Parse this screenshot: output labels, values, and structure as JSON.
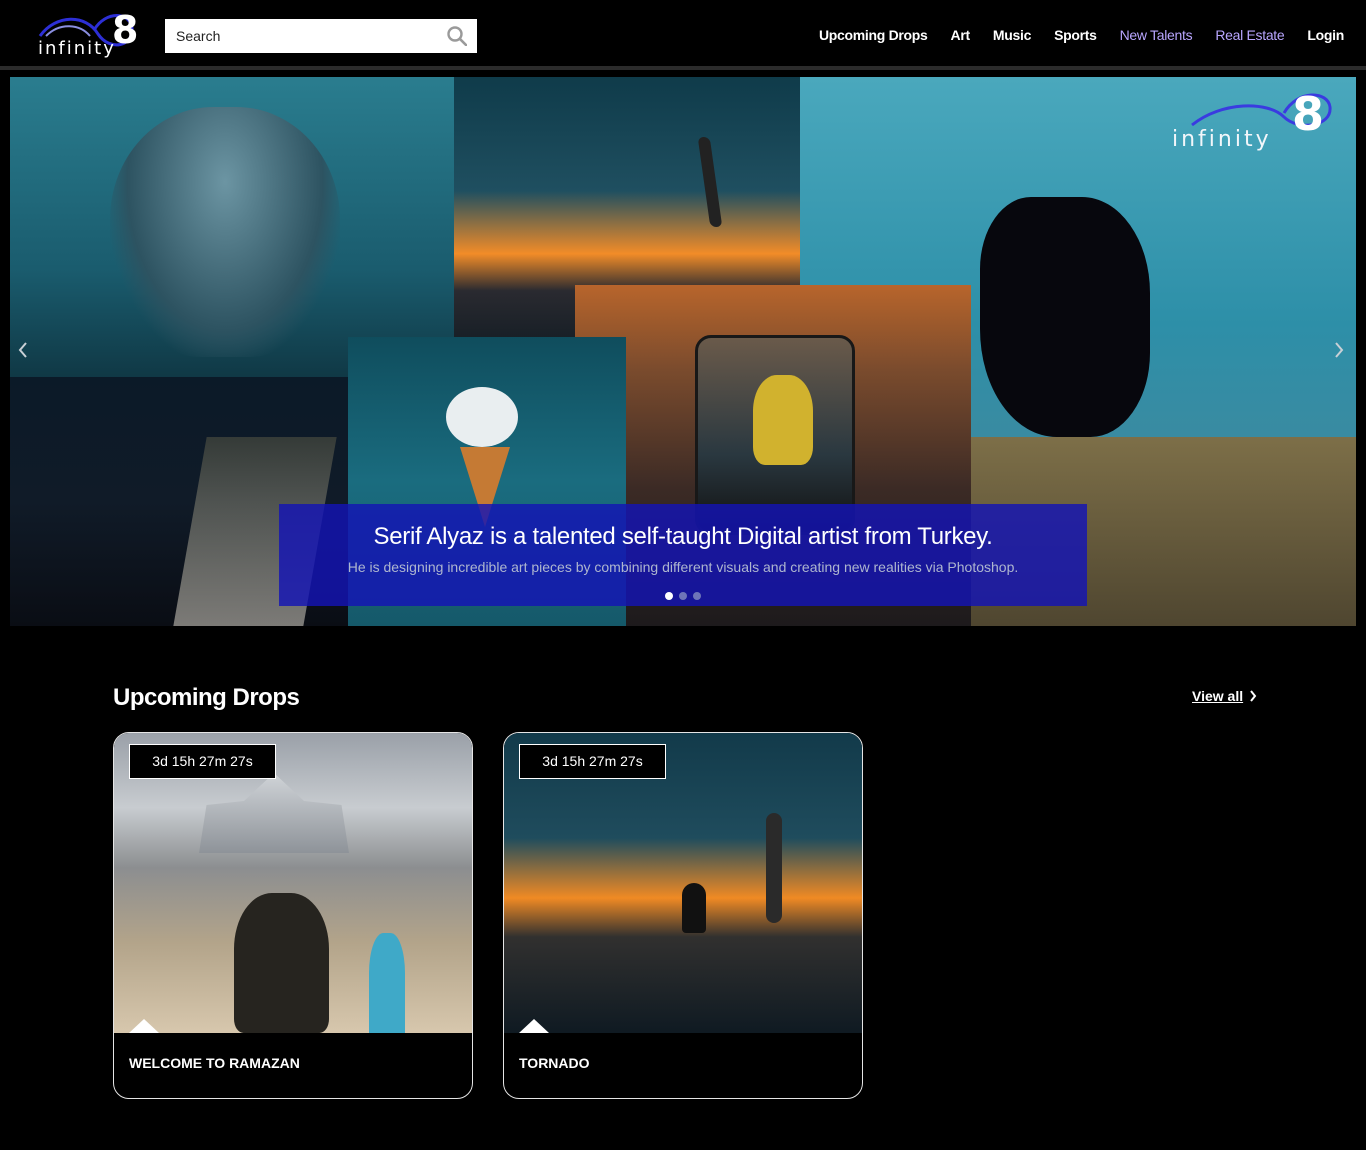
{
  "header": {
    "logo_word": "infinity",
    "logo_mark": "8",
    "search_placeholder": "Search",
    "nav": [
      {
        "label": "Upcoming Drops"
      },
      {
        "label": "Art"
      },
      {
        "label": "Music"
      },
      {
        "label": "Sports"
      },
      {
        "label": "New Talents",
        "color": "#b9a6ff"
      },
      {
        "label": "Real Estate",
        "color": "#b9a6ff"
      },
      {
        "label": "Login"
      }
    ]
  },
  "hero": {
    "watermark_word": "infinity",
    "watermark_mark": "8",
    "caption_title": "Serif Alyaz is a talented self-taught Digital artist from Turkey.",
    "caption_subtitle": "He is designing incredible art pieces by combining different visuals and creating new realities via Photoshop.",
    "slides": 3,
    "active_slide": 1,
    "caption_bg": "#1414b4"
  },
  "upcoming": {
    "title": "Upcoming Drops",
    "view_all": "View all",
    "cards": [
      {
        "countdown": "3d 15h 27m 27s",
        "title": "WELCOME TO RAMAZAN"
      },
      {
        "countdown": "3d 15h 27m 27s",
        "title": "TORNADO"
      }
    ]
  }
}
